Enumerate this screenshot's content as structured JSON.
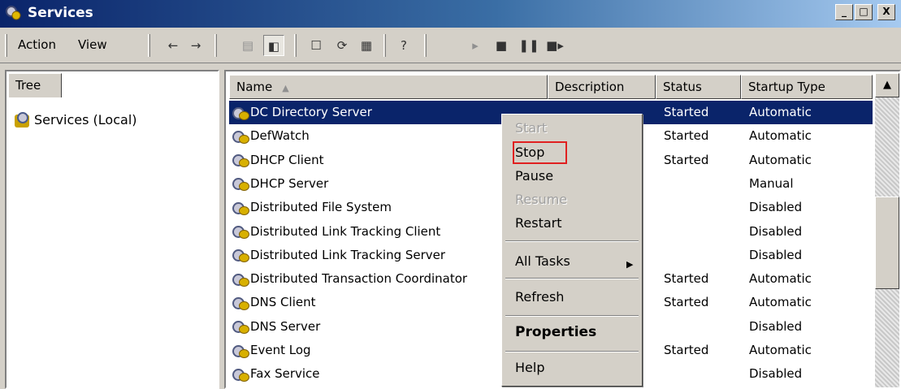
{
  "window": {
    "title": "Services",
    "minimize": "_",
    "maximize": "□",
    "close": "X"
  },
  "menu": {
    "action": "Action",
    "view": "View"
  },
  "toolbar_icons": [
    "back-icon",
    "forward-icon",
    "up-icon",
    "show-hide-tree-icon",
    "properties-icon",
    "refresh-icon",
    "export-list-icon",
    "help-icon",
    "start-icon",
    "stop-icon",
    "pause-icon",
    "restart-icon"
  ],
  "tree": {
    "tab": "Tree",
    "root": "Services (Local)"
  },
  "columns": {
    "name": "Name",
    "description": "Description",
    "status": "Status",
    "startup": "Startup Type"
  },
  "services": [
    {
      "name": "DC Directory Server",
      "status": "Started",
      "startup": "Automatic"
    },
    {
      "name": "DefWatch",
      "status": "Started",
      "startup": "Automatic"
    },
    {
      "name": "DHCP Client",
      "status": "Started",
      "startup": "Automatic"
    },
    {
      "name": "DHCP Server",
      "status": "",
      "startup": "Manual"
    },
    {
      "name": "Distributed File System",
      "status": "",
      "startup": "Disabled"
    },
    {
      "name": "Distributed Link Tracking Client",
      "status": "",
      "startup": "Disabled"
    },
    {
      "name": "Distributed Link Tracking Server",
      "status": "",
      "startup": "Disabled"
    },
    {
      "name": "Distributed Transaction Coordinator",
      "status": "Started",
      "startup": "Automatic"
    },
    {
      "name": "DNS Client",
      "status": "Started",
      "startup": "Automatic"
    },
    {
      "name": "DNS Server",
      "status": "",
      "startup": "Disabled"
    },
    {
      "name": "Event Log",
      "status": "Started",
      "startup": "Automatic"
    },
    {
      "name": "Fax Service",
      "status": "",
      "startup": "Disabled"
    }
  ],
  "context_menu": {
    "start": "Start",
    "stop": "Stop",
    "pause": "Pause",
    "resume": "Resume",
    "restart": "Restart",
    "all_tasks": "All Tasks",
    "refresh": "Refresh",
    "properties": "Properties",
    "help": "Help"
  },
  "colors": {
    "selection": "#0a246a",
    "highlight_box": "#e02020"
  }
}
